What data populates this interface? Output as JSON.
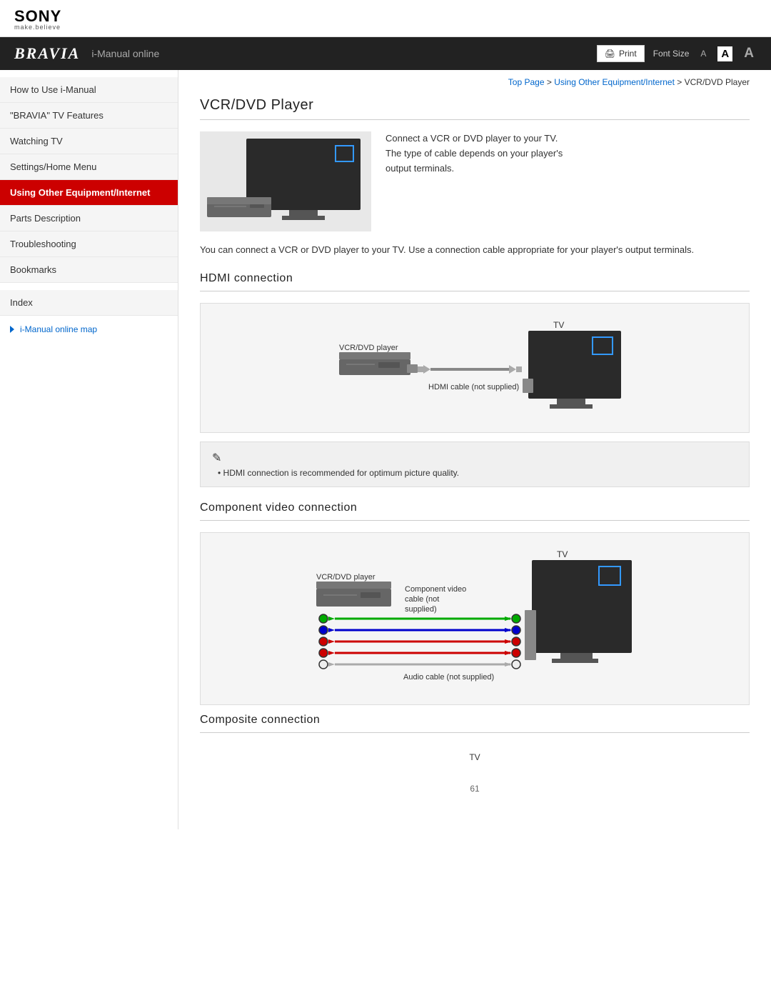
{
  "header": {
    "sony_logo": "SONY",
    "sony_tagline": "make.believe",
    "bravia_title": "BRAVIA",
    "bravia_subtitle": "i-Manual online",
    "print_label": "Print",
    "font_size_label": "Font Size",
    "font_sizes": [
      "A",
      "A",
      "A"
    ]
  },
  "sidebar": {
    "items": [
      {
        "id": "how-to-use",
        "label": "How to Use i-Manual",
        "active": false
      },
      {
        "id": "bravia-tv-features",
        "label": "\"BRAVIA\" TV Features",
        "active": false
      },
      {
        "id": "watching-tv",
        "label": "Watching TV",
        "active": false
      },
      {
        "id": "settings-home-menu",
        "label": "Settings/Home Menu",
        "active": false
      },
      {
        "id": "using-other-equipment",
        "label": "Using Other Equipment/Internet",
        "active": true
      },
      {
        "id": "parts-description",
        "label": "Parts Description",
        "active": false
      },
      {
        "id": "troubleshooting",
        "label": "Troubleshooting",
        "active": false
      },
      {
        "id": "bookmarks",
        "label": "Bookmarks",
        "active": false
      }
    ],
    "index_label": "Index",
    "map_link": "i-Manual online map"
  },
  "breadcrumb": {
    "top_page": "Top Page",
    "separator1": " > ",
    "using_equipment": "Using Other Equipment/Internet",
    "separator2": " > ",
    "current": "VCR/DVD Player"
  },
  "content": {
    "page_title": "VCR/DVD Player",
    "intro_text": "Connect a VCR or DVD player to your TV.\nThe type of cable depends on your player's\noutput terminals.",
    "desc_para": "You can connect a VCR or DVD player to your TV.  Use a connection cable appropriate for your player's output terminals.",
    "hdmi_section": {
      "title": "HDMI connection",
      "tv_label": "TV",
      "vcr_label": "VCR/DVD player",
      "cable_label": "HDMI cable (not supplied)",
      "note_icon": "✎",
      "note_text": "HDMI connection is recommended for optimum picture quality."
    },
    "component_section": {
      "title": "Component video connection",
      "tv_label": "TV",
      "vcr_label": "VCR/DVD player",
      "cable_label": "Component video\ncable (not\nsupplied)",
      "audio_label": "Audio cable (not supplied)"
    },
    "composite_section": {
      "title": "Composite connection",
      "tv_label": "TV"
    },
    "page_number": "61"
  }
}
